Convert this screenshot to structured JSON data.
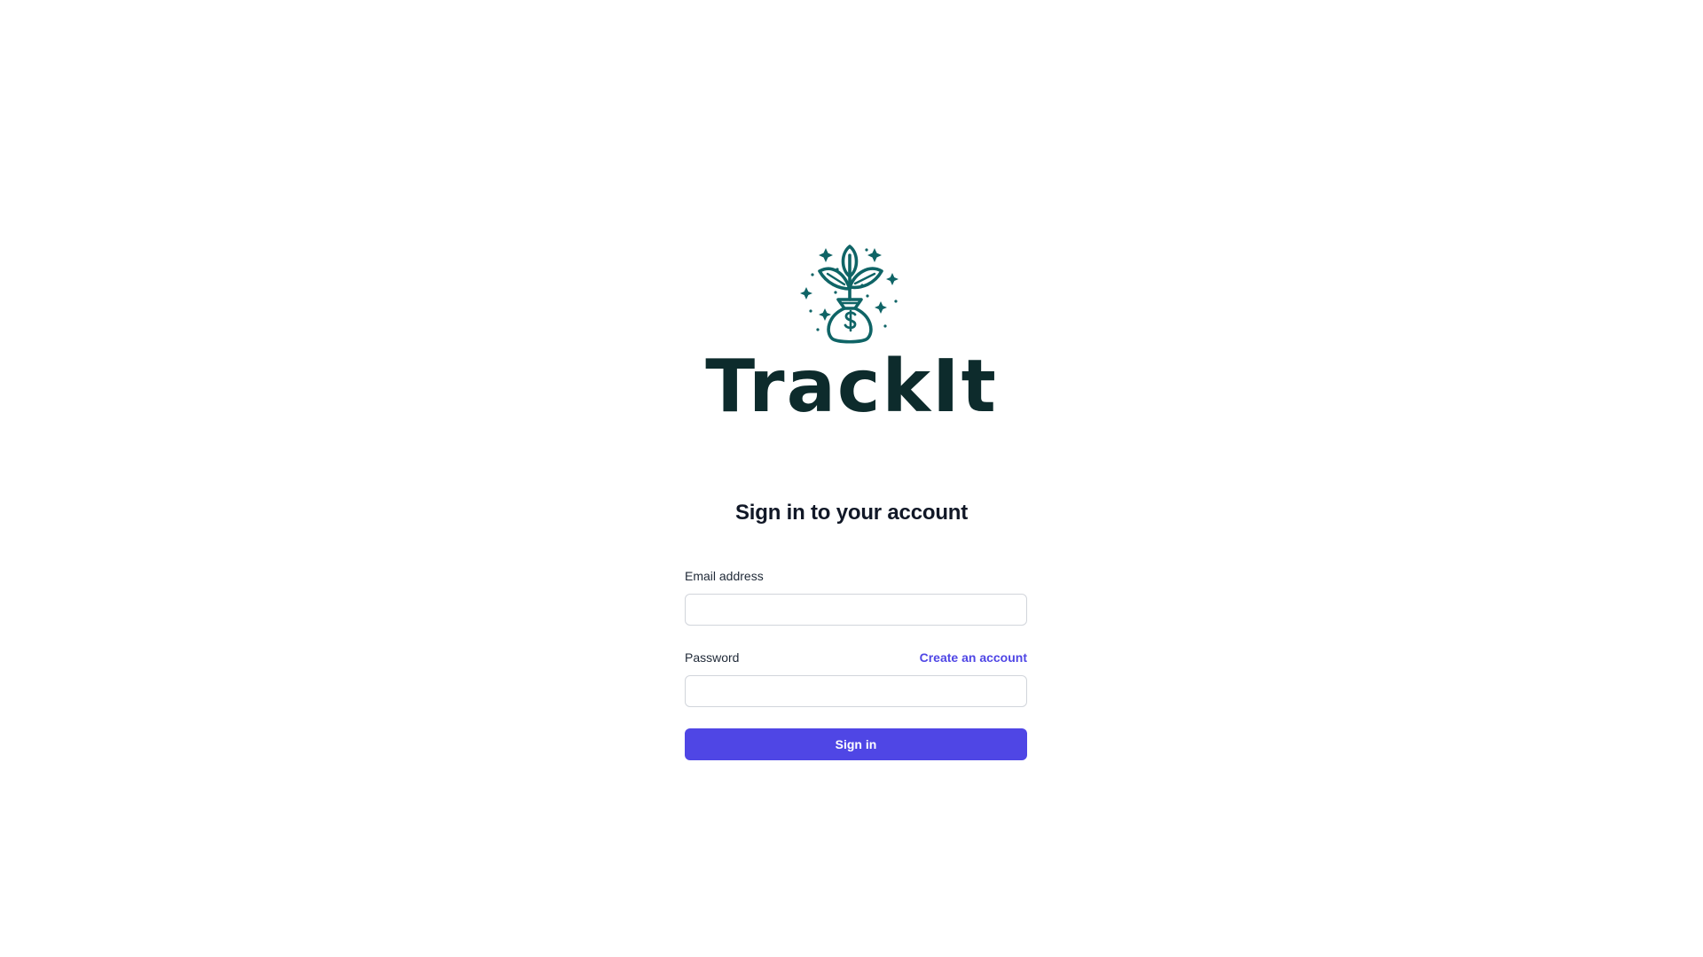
{
  "brand": {
    "name": "TrackIt",
    "logo_icon": "money-bag-plant-icon",
    "logo_color": "#0f6466",
    "text_color": "#0d2b2c"
  },
  "login": {
    "heading": "Sign in to your account",
    "email_label": "Email address",
    "email_value": "",
    "password_label": "Password",
    "password_value": "",
    "create_account_link": "Create an account",
    "submit_label": "Sign in"
  },
  "colors": {
    "accent": "#4f46e5",
    "input_border": "#d1d5db",
    "heading": "#111827"
  }
}
